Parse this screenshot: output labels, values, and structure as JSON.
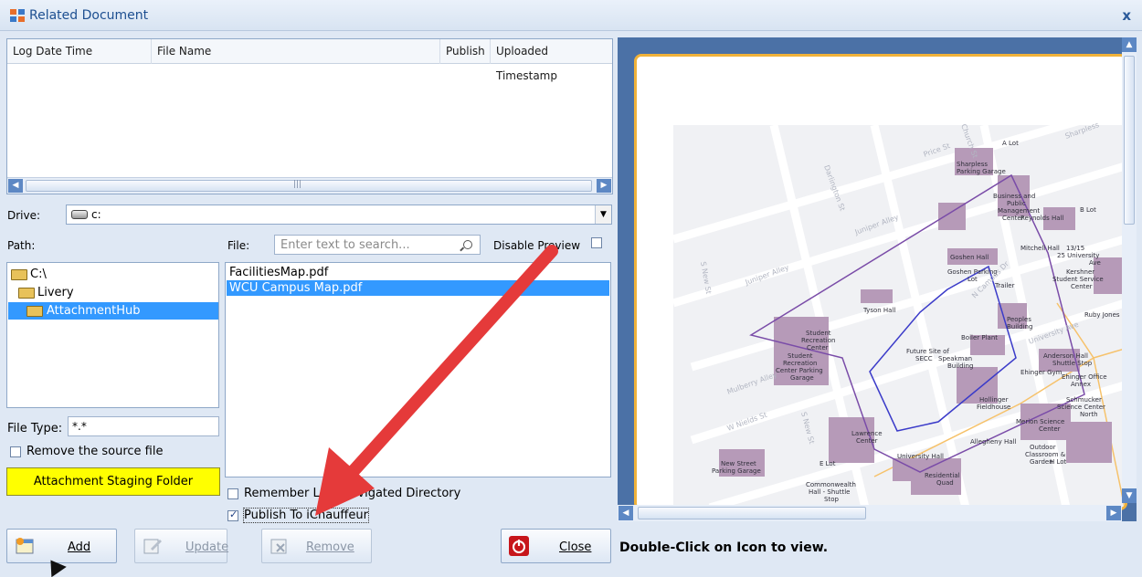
{
  "window": {
    "title": "Related Document",
    "close_glyph": "x"
  },
  "grid": {
    "columns": [
      "Log Date Time",
      "File Name",
      "Publish",
      "Uploaded Timestamp"
    ],
    "scroll_grip": "|||"
  },
  "drive": {
    "label": "Drive:",
    "value": "c:"
  },
  "path": {
    "label": "Path:",
    "items": [
      "C:\\",
      "Livery",
      "AttachmentHub"
    ],
    "selected_index": 2
  },
  "file": {
    "label": "File:",
    "search_placeholder": "Enter text to search...",
    "disable_preview_label": "Disable Preview",
    "disable_preview_checked": false,
    "items": [
      "FacilitiesMap.pdf",
      "WCU Campus Map.pdf"
    ],
    "selected_index": 1
  },
  "file_type": {
    "label": "File Type:",
    "value": "*.*"
  },
  "remove_source": {
    "label": "Remove the source file",
    "checked": false
  },
  "staging_button": {
    "label": "Attachment Staging Folder"
  },
  "remember_dir": {
    "label": "Remember Last Navigated Directory",
    "checked": false
  },
  "publish": {
    "label": "Publish To iChauffeur",
    "checked": true
  },
  "buttons": {
    "add": "Add",
    "update": "Update",
    "remove": "Remove",
    "close": "Close"
  },
  "hint": "Double-Click on Icon to view.",
  "map": {
    "labels": [
      "A Lot",
      "Sharpless Parking Garage",
      "Business and Public Management Center",
      "B Lot",
      "Reynolds Hall",
      "Mitchell Hall",
      "13/15 University Ave",
      "25 University Ave",
      "Kershner Student Service Center",
      "Goshen Hall",
      "Goshen Parking Lot",
      "Trailer",
      "Tyson Hall",
      "Peoples Building",
      "Ruby Jones",
      "Student Recreation Center",
      "Boiler Plant",
      "Student Recreation Center Parking Garage",
      "Future Site of SECC",
      "Speakman Building",
      "Anderson Hall",
      "Shuttle Stop",
      "Ehinger Gym",
      "Ehinger Office Annex",
      "Hollinger Fieldhouse",
      "Schmucker Science Center North",
      "Merion Science Center",
      "Lawrence Center",
      "Allegheny Hall",
      "Outdoor Classroom & Garden",
      "New Street Parking Garage",
      "E Lot",
      "University Hall",
      "Residential Quad",
      "Commonwealth Hall - Shuttle Stop"
    ],
    "streets": [
      "Darlington St",
      "Price St",
      "Church St",
      "Juniper Alley",
      "S New St",
      "Mulberry Alley",
      "W Nields St",
      "S New St",
      "N Campus Dr",
      "University Ave",
      "Sharpless"
    ]
  },
  "colors": {
    "selection": "#3399ff",
    "staging_button": "#ffff00",
    "arrow": "#e53a3a",
    "preview_frame": "#f0b23a",
    "building": "#b69ab8"
  }
}
